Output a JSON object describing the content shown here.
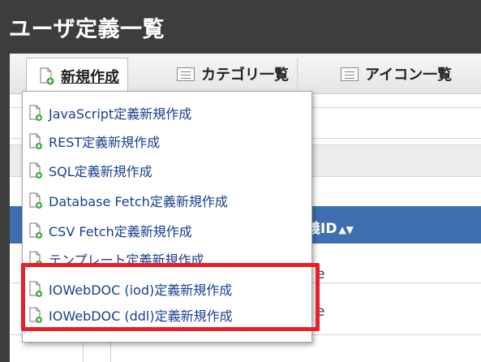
{
  "window": {
    "title": "ユーザ定義一覧"
  },
  "toolbar": {
    "new_label": "新規作成",
    "category_label": "カテゴリ一覧",
    "icon_label": "アイコン一覧"
  },
  "table": {
    "id_header": "義ID",
    "sort_glyph": "▲▼",
    "rows": [
      {
        "cell": "e"
      },
      {
        "cell": "e"
      }
    ]
  },
  "menu": {
    "items": [
      {
        "label": "JavaScript定義新規作成"
      },
      {
        "label": "REST定義新規作成"
      },
      {
        "label": "SQL定義新規作成"
      },
      {
        "label": "Database Fetch定義新規作成"
      },
      {
        "label": "CSV Fetch定義新規作成"
      },
      {
        "label": "テンプレート定義新規作成"
      },
      {
        "label": "IOWebDOC (iod)定義新規作成"
      },
      {
        "label": "IOWebDOC (ddl)定義新規作成"
      }
    ]
  },
  "annotation": {
    "highlight_color": "#e8202a"
  },
  "colors": {
    "titlebar": "#3d3d3d",
    "table_header": "#3e6fb0",
    "menu_link": "#1a3f8f",
    "plus_badge": "#3aa63a"
  }
}
